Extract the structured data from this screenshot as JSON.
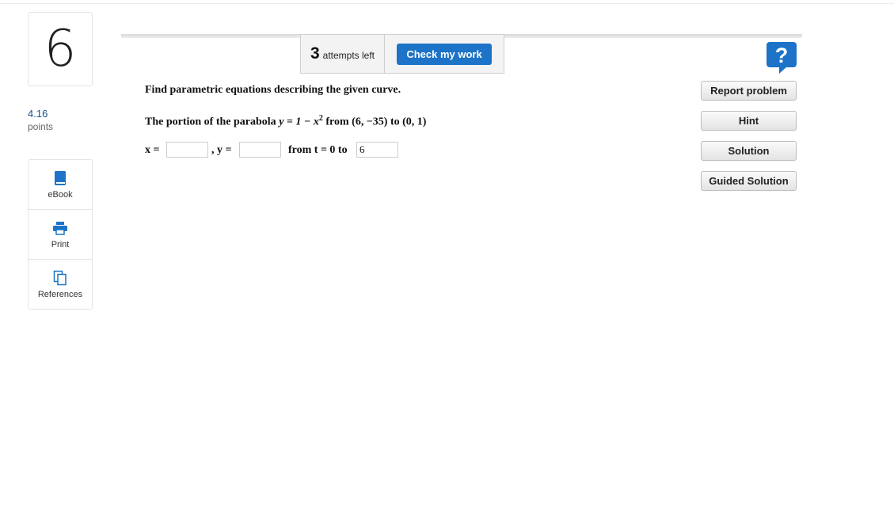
{
  "question": {
    "number": "6",
    "points_value": "4.16",
    "points_label": "points"
  },
  "tools": [
    {
      "label": "eBook",
      "icon": "book-icon"
    },
    {
      "label": "Print",
      "icon": "printer-icon"
    },
    {
      "label": "References",
      "icon": "copy-icon"
    }
  ],
  "header": {
    "attempts_count": "3",
    "attempts_text": "attempts left",
    "check_label": "Check my work",
    "help_icon": "question-mark-icon"
  },
  "problem": {
    "instruction": "Find parametric equations describing the given curve.",
    "curve_prefix": "The portion of the parabola ",
    "curve_equation": "y = 1 − x",
    "curve_exponent": "2",
    "curve_suffix": " from (6, −35) to (0, 1)",
    "x_label": "x =",
    "x_value": "",
    "y_label": ", y =",
    "y_value": "",
    "t_range_label": "from t = 0 to",
    "t_end_value": "6"
  },
  "side_buttons": {
    "report_label": "Report problem",
    "hint_label": "Hint",
    "solution_label": "Solution",
    "guided_label": "Guided Solution"
  },
  "colors": {
    "primary_blue": "#1c73c7",
    "points_blue": "#1a4f8b"
  }
}
